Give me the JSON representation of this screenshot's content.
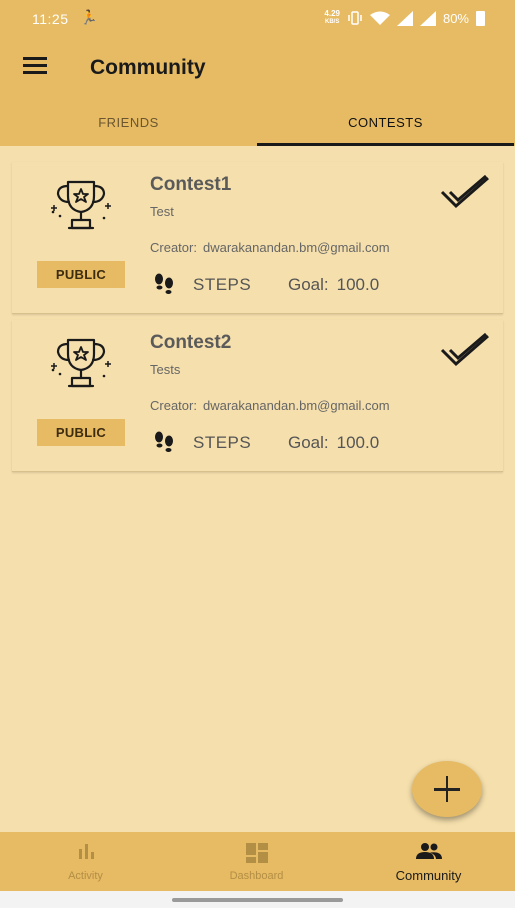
{
  "status_bar": {
    "time": "11:25",
    "network_speed": "4.29",
    "network_unit": "KB/S",
    "battery": "80%"
  },
  "app_bar": {
    "title": "Community"
  },
  "tabs": [
    {
      "label": "FRIENDS",
      "active": false
    },
    {
      "label": "CONTESTS",
      "active": true
    }
  ],
  "contests": [
    {
      "name": "Contest1",
      "description": "Test",
      "creator_label": "Creator:",
      "creator": "dwarakanandan.bm@gmail.com",
      "visibility": "PUBLIC",
      "type": "STEPS",
      "goal_label": "Goal:",
      "goal": "100.0",
      "joined": true
    },
    {
      "name": "Contest2",
      "description": "Tests",
      "creator_label": "Creator:",
      "creator": "dwarakanandan.bm@gmail.com",
      "visibility": "PUBLIC",
      "type": "STEPS",
      "goal_label": "Goal:",
      "goal": "100.0",
      "joined": true
    }
  ],
  "fab": {
    "icon": "plus-icon"
  },
  "bottom_nav": [
    {
      "label": "Activity",
      "icon": "bar-chart-icon",
      "active": false
    },
    {
      "label": "Dashboard",
      "icon": "dashboard-icon",
      "active": false
    },
    {
      "label": "Community",
      "icon": "people-icon",
      "active": true
    }
  ],
  "colors": {
    "primary": "#e6bb64",
    "background": "#f5dfac",
    "text_dark": "#1a1a1a"
  }
}
